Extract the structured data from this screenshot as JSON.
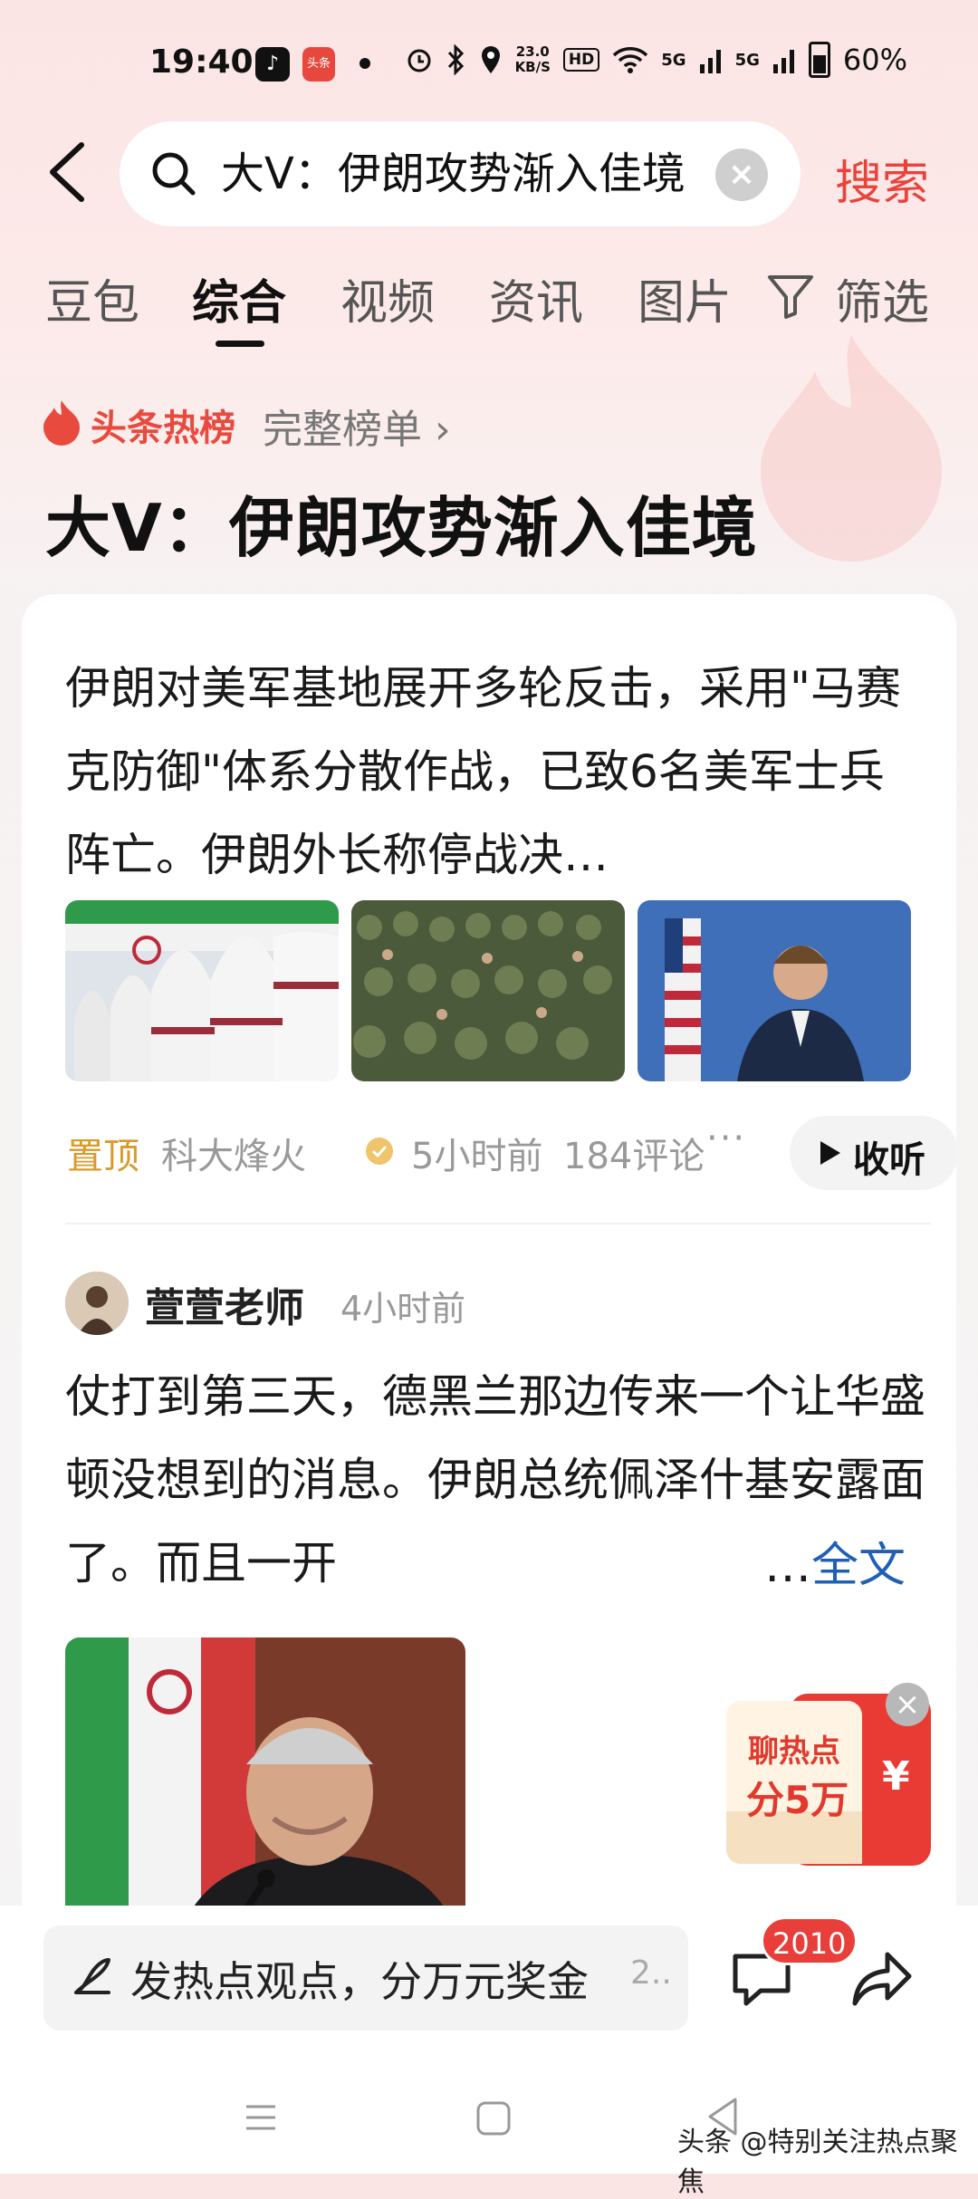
{
  "status_bar": {
    "time": "19:40",
    "speed_value": "23.0",
    "speed_unit": "KB/S",
    "hd": "HD",
    "net1": "5G",
    "net2": "5G",
    "battery": "60%",
    "toutiao_label": "头条"
  },
  "search": {
    "query": "大V：伊朗攻势渐入佳境",
    "submit_label": "搜索"
  },
  "tabs": [
    "豆包",
    "综合",
    "视频",
    "资讯",
    "图片"
  ],
  "filter_label": "筛选",
  "hot": {
    "label": "头条热榜",
    "full_list": "完整榜单 ›",
    "title": "大V：伊朗攻势渐入佳境"
  },
  "post1": {
    "text": "伊朗对美军基地展开多轮反击，采用\"马赛克防御\"体系分散作战，已致6名美军士兵阵亡。伊朗外长称停战决…",
    "pin": "置顶",
    "author": "科大烽火",
    "time": "5小时前",
    "comments": "184评论",
    "more": "···",
    "listen": "收听"
  },
  "post2": {
    "author": "萱萱老师",
    "time": "4小时前",
    "text": "仗打到第三天，德黑兰那边传来一个让华盛顿没想到的消息。伊朗总统佩泽什基安露面了。而且一开",
    "ellipsis": "…",
    "full_text": "全文"
  },
  "promo": {
    "line1": "聊热点",
    "line2": "分5万",
    "currency": "¥"
  },
  "bottom": {
    "input_text": "发热点观点，分万元奖金",
    "input_more": "2..",
    "badge": "2010"
  },
  "watermark": "头条 @特别关注热点聚焦",
  "colors": {
    "accent_red": "#e9433b",
    "pin_gold": "#d99a2a",
    "link_blue": "#1f5fb5"
  }
}
